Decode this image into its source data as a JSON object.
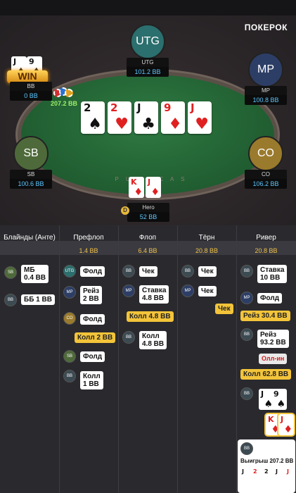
{
  "brand": "ПОКЕРОК",
  "table": {
    "rail_text": "P U S H C A S H",
    "win_label": "WIN",
    "pot": "207.2 BB",
    "dealer": "D"
  },
  "seats": {
    "utg": {
      "label": "UTG",
      "name": "UTG",
      "stack": "101.2 BB"
    },
    "mp": {
      "label": "MP",
      "name": "MP",
      "stack": "100.8 BB"
    },
    "sb": {
      "label": "SB",
      "name": "SB",
      "stack": "100.6 BB"
    },
    "co": {
      "label": "CO",
      "name": "CO",
      "stack": "106.2 BB"
    },
    "bb": {
      "name": "BB",
      "stack": "0 BB",
      "cards": [
        {
          "rank": "J",
          "suit": "♠"
        },
        {
          "rank": "9",
          "suit": "♠"
        }
      ]
    },
    "hero": {
      "name": "Hero",
      "stack": "52 BB",
      "cards": [
        {
          "rank": "K",
          "suit": "♦"
        },
        {
          "rank": "J",
          "suit": "♦"
        }
      ]
    }
  },
  "board": [
    {
      "rank": "2",
      "suit": "♠",
      "color": "blk"
    },
    {
      "rank": "2",
      "suit": "♥",
      "color": "red"
    },
    {
      "rank": "J",
      "suit": "♣",
      "color": "blk"
    },
    {
      "rank": "9",
      "suit": "♦",
      "color": "red"
    },
    {
      "rank": "J",
      "suit": "♥",
      "color": "red"
    }
  ],
  "streets": [
    {
      "title": "Блайнды (Анте)",
      "pot": ""
    },
    {
      "title": "Префлоп",
      "pot": "1.4 BB"
    },
    {
      "title": "Флоп",
      "pot": "6.4 BB"
    },
    {
      "title": "Тёрн",
      "pot": "20.8 BB"
    },
    {
      "title": "Ривер",
      "pot": "20.8 BB"
    }
  ],
  "actions": {
    "blinds": [
      {
        "pos": "SB",
        "text": "МБ\n0.4 BB"
      },
      {
        "pos": "BB",
        "text": "ББ 1 BB"
      }
    ],
    "preflop": [
      {
        "pos": "UTG",
        "text": "Фолд"
      },
      {
        "pos": "MP",
        "text": "Рейз\n2 BB"
      },
      {
        "pos": "CO",
        "text": "Фолд"
      },
      {
        "hero": true,
        "text": "Колл 2 BB"
      },
      {
        "pos": "SB",
        "text": "Фолд"
      },
      {
        "pos": "BB",
        "text": "Колл\n1 BB"
      }
    ],
    "flop": [
      {
        "pos": "BB",
        "text": "Чек"
      },
      {
        "pos": "MP",
        "text": "Ставка\n4.8 BB"
      },
      {
        "hero": true,
        "text": "Колл 4.8 BB"
      },
      {
        "pos": "BB",
        "text": "Колл\n4.8 BB"
      }
    ],
    "turn": [
      {
        "pos": "BB",
        "text": "Чек"
      },
      {
        "pos": "MP",
        "text": "Чек"
      },
      {
        "hero": true,
        "text": "Чек"
      }
    ],
    "river": [
      {
        "pos": "BB",
        "text": "Ставка\n10 BB"
      },
      {
        "pos": "MP",
        "text": "Фолд"
      },
      {
        "hero": true,
        "text": "Рейз 30.4 BB"
      },
      {
        "pos": "BB",
        "text": "Рейз\n93.2 BB"
      },
      {
        "allin": true,
        "text": "Олл-ин"
      },
      {
        "hero": true,
        "text": "Колл 62.8 BB"
      }
    ]
  },
  "result": {
    "pos": "BB",
    "text": "Выигрыш 207.2 BB"
  }
}
